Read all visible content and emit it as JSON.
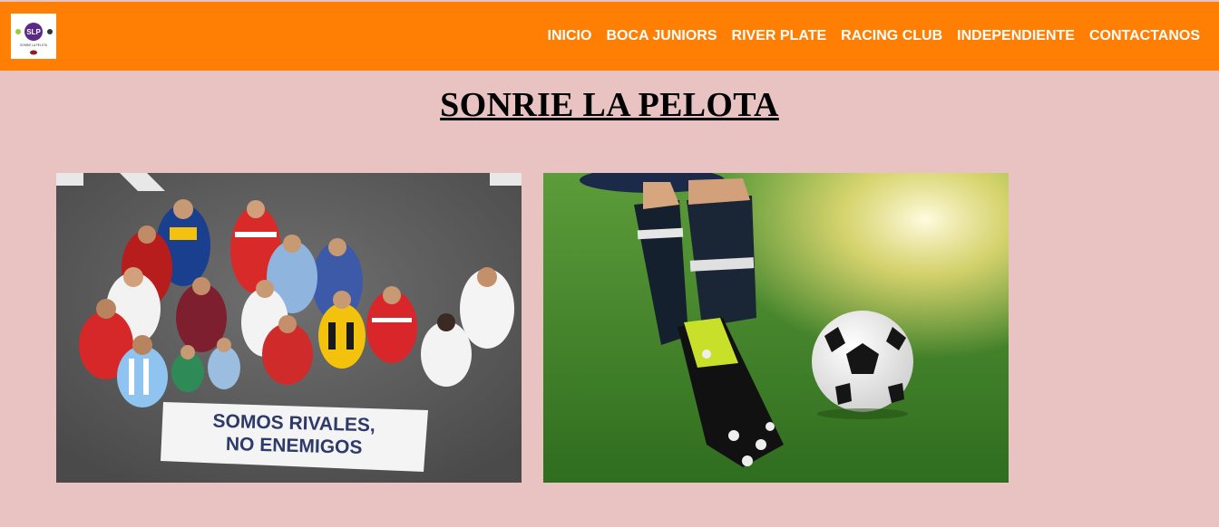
{
  "header": {
    "logo": {
      "text": "SLP",
      "subtext": "SONRIE LA PELOTA",
      "icon": "soccer-ball-logo"
    },
    "nav": [
      {
        "label": "INICIO"
      },
      {
        "label": "BOCA JUNIORS"
      },
      {
        "label": "RIVER PLATE"
      },
      {
        "label": "RACING CLUB"
      },
      {
        "label": "INDEPENDIENTE"
      },
      {
        "label": "CONTACTANOS"
      }
    ]
  },
  "main": {
    "title": "SONRIE LA PELOTA",
    "images": [
      {
        "name": "fans-photo",
        "banner_line1": "SOMOS RIVALES,",
        "banner_line2": "NO ENEMIGOS"
      },
      {
        "name": "soccer-kick-photo"
      }
    ]
  },
  "colors": {
    "navbar": "#fe7f03",
    "background": "#e8c3c2",
    "nav_text": "#ffffff",
    "title": "#000000"
  }
}
